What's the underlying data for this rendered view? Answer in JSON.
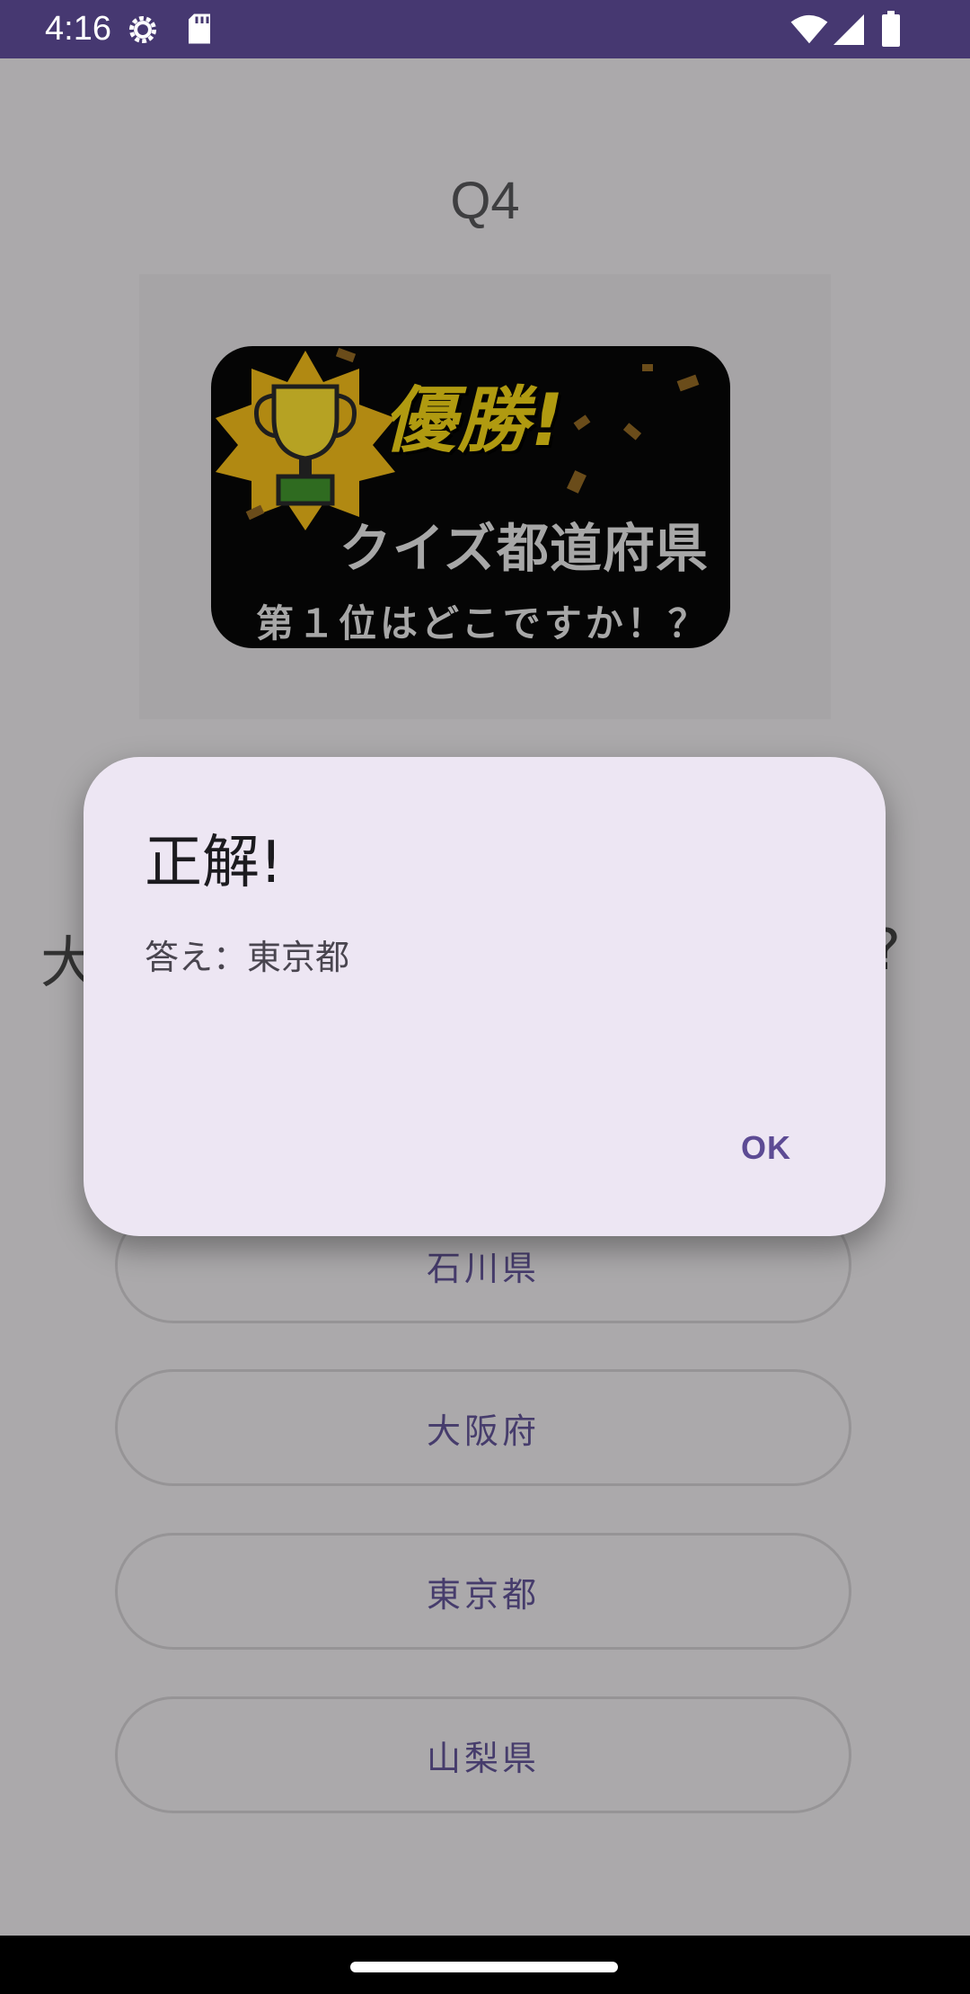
{
  "status_bar": {
    "time": "4:16",
    "icons": [
      "settings-gear-icon",
      "sd-card-icon",
      "wifi-icon",
      "cell-signal-icon",
      "battery-icon"
    ]
  },
  "quiz": {
    "question_number": "Q4",
    "banner": {
      "headline": "優勝!",
      "title": "クイズ都道府県",
      "subtitle": "第１位はどこですか！？"
    },
    "question_left_fragment": "大",
    "question_right_fragment": "?",
    "choices": [
      "石川県",
      "大阪府",
      "東京都",
      "山梨県"
    ]
  },
  "dialog": {
    "title": "正解!",
    "message": "答え：東京都",
    "ok_label": "OK"
  },
  "colors": {
    "status_bar": "#463871",
    "scrim_background": "#aba9ab",
    "dialog_background": "#ede6f3",
    "accent": "#5d4b94"
  }
}
